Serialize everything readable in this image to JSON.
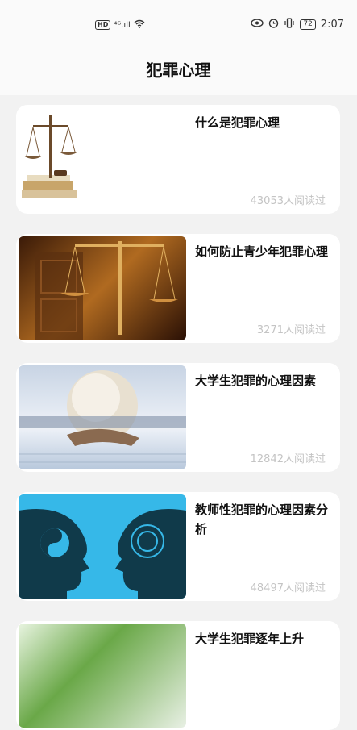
{
  "status_bar": {
    "hd": "HD",
    "signal": "⁴ᴳ.ıll",
    "battery": "72",
    "time": "2:07"
  },
  "header": {
    "title": "犯罪心理"
  },
  "articles": [
    {
      "title": "什么是犯罪心理",
      "reads": "43053人阅读过",
      "thumb": "scales-of-justice"
    },
    {
      "title": "如何防止青少年犯罪心理",
      "reads": "3271人阅读过",
      "thumb": "scales-in-courtroom"
    },
    {
      "title": "大学生犯罪的心理因素",
      "reads": "12842人阅读过",
      "thumb": "handshake-globe"
    },
    {
      "title": "教师性犯罪的心理因素分析",
      "reads": "48497人阅读过",
      "thumb": "two-heads-yin-yang"
    },
    {
      "title": "大学生犯罪逐年上升",
      "reads": "",
      "thumb": "green-leaves"
    }
  ]
}
